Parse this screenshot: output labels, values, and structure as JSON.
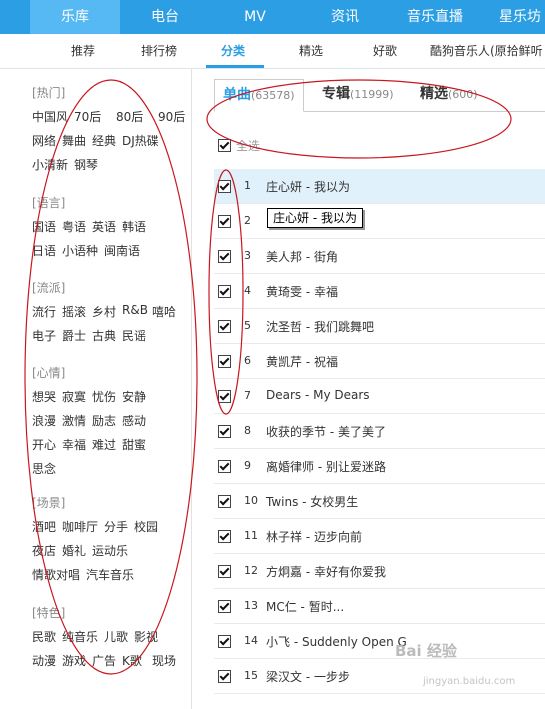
{
  "topnav": [
    {
      "label": "乐库",
      "active": true
    },
    {
      "label": "电台",
      "active": false
    },
    {
      "label": "MV",
      "active": false
    },
    {
      "label": "资讯",
      "active": false
    },
    {
      "label": "音乐直播",
      "active": false
    },
    {
      "label": "星乐坊",
      "active": false
    }
  ],
  "subnav": [
    {
      "label": "推荐",
      "active": false
    },
    {
      "label": "排行榜",
      "active": false
    },
    {
      "label": "分类",
      "active": true
    },
    {
      "label": "精选",
      "active": false
    },
    {
      "label": "好歌",
      "active": false
    },
    {
      "label": "酷狗音乐人(原拾鲜听",
      "active": false
    }
  ],
  "categories": [
    {
      "title": "[热门]",
      "rows": [
        [
          "中国风",
          "70后",
          "80后",
          "90后"
        ],
        [
          "网络",
          "舞曲",
          "经典",
          "DJ热碟"
        ],
        [
          "小清新",
          "钢琴"
        ]
      ]
    },
    {
      "title": "[语言]",
      "rows": [
        [
          "国语",
          "粤语",
          "英语",
          "韩语"
        ],
        [
          "日语",
          "小语种",
          "闽南语"
        ]
      ]
    },
    {
      "title": "[流派]",
      "rows": [
        [
          "流行",
          "摇滚",
          "乡村",
          "R&B",
          "嘻哈"
        ],
        [
          "电子",
          "爵士",
          "古典",
          "民谣"
        ]
      ]
    },
    {
      "title": "[心情]",
      "rows": [
        [
          "想哭",
          "寂寞",
          "忧伤",
          "安静"
        ],
        [
          "浪漫",
          "激情",
          "励志",
          "感动"
        ],
        [
          "开心",
          "幸福",
          "难过",
          "甜蜜"
        ],
        [
          "思念"
        ]
      ]
    },
    {
      "title": "[场景]",
      "rows": [
        [
          "酒吧",
          "咖啡厅",
          "分手",
          "校园"
        ],
        [
          "夜店",
          "婚礼",
          "运动乐"
        ],
        [
          "情歌对唱",
          "汽车音乐"
        ]
      ]
    },
    {
      "title": "[特色]",
      "rows": [
        [
          "民歌",
          "纯音乐",
          "儿歌",
          "影视"
        ],
        [
          "动漫",
          "游戏",
          "广告",
          "K歌",
          "现场"
        ]
      ]
    }
  ],
  "tabs": [
    {
      "label": "单曲",
      "count": "(63578)",
      "active": true
    },
    {
      "label": "专辑",
      "count": "(11999)",
      "active": false
    },
    {
      "label": "精选",
      "count": "(600)",
      "active": false
    }
  ],
  "select_all": "全选",
  "songs": [
    {
      "num": "1",
      "title": "庄心妍 - 我以为",
      "selected": true
    },
    {
      "num": "2",
      "title": "",
      "selected": false
    },
    {
      "num": "3",
      "title": "美人邦 - 街角",
      "selected": false
    },
    {
      "num": "4",
      "title": "黄琦雯 - 幸福",
      "selected": false
    },
    {
      "num": "5",
      "title": "沈圣哲 - 我们跳舞吧",
      "selected": false
    },
    {
      "num": "6",
      "title": "黄凯芹 - 祝福",
      "selected": false
    },
    {
      "num": "7",
      "title": "Dears - My Dears",
      "selected": false
    },
    {
      "num": "8",
      "title": "收获的季节 - 美了美了",
      "selected": false
    },
    {
      "num": "9",
      "title": "离婚律师 - 别让爱迷路",
      "selected": false
    },
    {
      "num": "10",
      "title": "Twins - 女校男生",
      "selected": false
    },
    {
      "num": "11",
      "title": "林子祥 - 迈步向前",
      "selected": false
    },
    {
      "num": "12",
      "title": "方炯嘉 - 幸好有你爱我",
      "selected": false
    },
    {
      "num": "13",
      "title": "MC仁 - 暂时...",
      "selected": false
    },
    {
      "num": "14",
      "title": "小飞 - Suddenly Open G",
      "selected": false
    },
    {
      "num": "15",
      "title": "梁汉文 - 一步步",
      "selected": false
    }
  ],
  "tooltip": "庄心妍 - 我以为",
  "watermark": {
    "main": "Bai 经验",
    "sub": "jingyan.baidu.com"
  }
}
